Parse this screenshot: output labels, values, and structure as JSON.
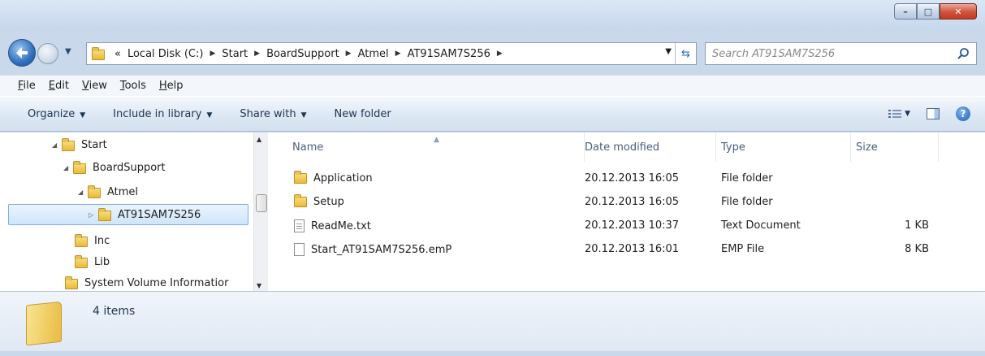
{
  "window": {
    "minimize": "–",
    "maximize": "□",
    "close": "✕"
  },
  "address": {
    "overflow": "«",
    "crumbs": [
      "Local Disk (C:)",
      "Start",
      "BoardSupport",
      "Atmel",
      "AT91SAM7S256"
    ]
  },
  "search": {
    "placeholder": "Search AT91SAM7S256"
  },
  "menu": {
    "file": "File",
    "edit": "Edit",
    "view": "View",
    "tools": "Tools",
    "help": "Help"
  },
  "commands": {
    "organize": "Organize",
    "include": "Include in library",
    "share": "Share with",
    "new_folder": "New folder"
  },
  "tree": {
    "items": [
      "Start",
      "BoardSupport",
      "Atmel",
      "AT91SAM7S256",
      "Inc",
      "Lib",
      "System Volume Informatior"
    ]
  },
  "columns": {
    "name": "Name",
    "date": "Date modified",
    "type": "Type",
    "size": "Size"
  },
  "files": [
    {
      "name": "Application",
      "date": "20.12.2013 16:05",
      "type": "File folder",
      "size": ""
    },
    {
      "name": "Setup",
      "date": "20.12.2013 16:05",
      "type": "File folder",
      "size": ""
    },
    {
      "name": "ReadMe.txt",
      "date": "20.12.2013 10:37",
      "type": "Text Document",
      "size": "1 KB"
    },
    {
      "name": "Start_AT91SAM7S256.emP",
      "date": "20.12.2013 16:01",
      "type": "EMP File",
      "size": "8 KB"
    }
  ],
  "status": {
    "count": "4 items"
  }
}
